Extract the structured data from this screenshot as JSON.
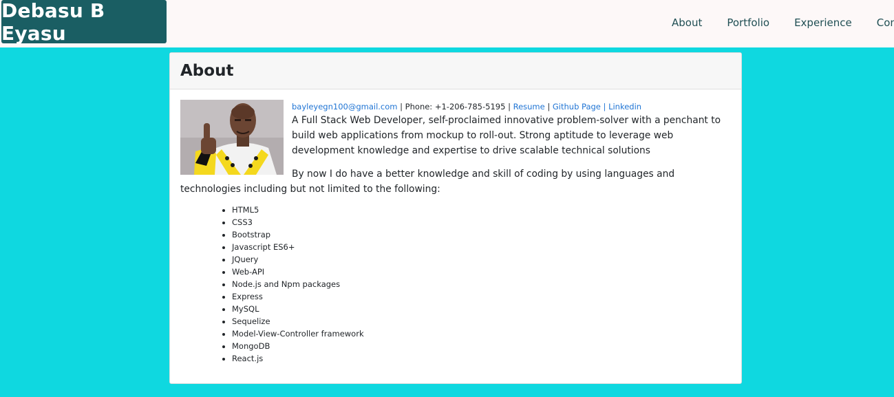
{
  "nav": {
    "brand": "Debasu B Eyasu",
    "links": [
      "About",
      "Portfolio",
      "Experience",
      "Contact"
    ]
  },
  "about": {
    "title": "About",
    "contact": {
      "email": "bayleyegn100@gmail.com",
      "phone": "| Phone: +1-206-785-5195 |",
      "resume": "Resume",
      "github": "Github Page",
      "linkedin": "Linkedin"
    },
    "intro": "A Full Stack Web Developer, self-proclaimed innovative problem-solver with a penchant to build web applications from mockup to roll-out. Strong aptitude to leverage web development knowledge and expertise to drive scalable technical solutions",
    "skills_intro": "By now I do have a better knowledge and skill of coding by using languages and technologies including but not limited to the following:",
    "skills": [
      "HTML5",
      "CSS3",
      "Bootstrap",
      "Javascript ES6+",
      "JQuery",
      "Web-API",
      "Node.js and Npm packages",
      "Express",
      "MySQL",
      "Sequelize",
      "Model-View-Controller framework",
      "MongoDB",
      "React.js"
    ]
  },
  "colors": {
    "page_background": "#0fd8e0",
    "brand_background": "#1a5e63",
    "link": "#1f74d4"
  }
}
